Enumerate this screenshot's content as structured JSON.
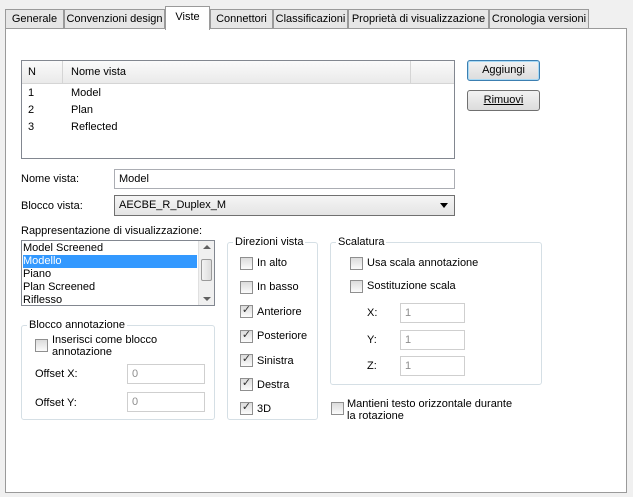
{
  "tabs": [
    {
      "label": "Generale"
    },
    {
      "label": "Convenzioni design"
    },
    {
      "label": "Viste"
    },
    {
      "label": "Connettori"
    },
    {
      "label": "Classificazioni"
    },
    {
      "label": "Proprietà di visualizzazione"
    },
    {
      "label": "Cronologia versioni"
    }
  ],
  "view_list": {
    "columns": [
      "N",
      "Nome vista"
    ],
    "rows": [
      {
        "n": "1",
        "name": "Model"
      },
      {
        "n": "2",
        "name": "Plan"
      },
      {
        "n": "3",
        "name": "Reflected"
      }
    ]
  },
  "buttons": {
    "add": "Aggiungi",
    "remove": "Rimuovi"
  },
  "view_name": {
    "label": "Nome vista:",
    "value": "Model"
  },
  "view_block": {
    "label": "Blocco vista:",
    "value": "AECBE_R_Duplex_M"
  },
  "display_rep": {
    "label": "Rappresentazione di visualizzazione:",
    "items": [
      "Model Screened",
      "Modello",
      "Piano",
      "Plan Screened",
      "Riflesso"
    ],
    "selected": "Modello"
  },
  "annotation_block": {
    "title": "Blocco annotazione",
    "insert_label_1": "Inserisci come blocco",
    "insert_label_2": "annotazione",
    "insert_checked": false,
    "offset_x_label": "Offset X:",
    "offset_x_value": "0",
    "offset_y_label": "Offset Y:",
    "offset_y_value": "0"
  },
  "view_directions": {
    "title": "Direzioni vista",
    "items": [
      {
        "label": "In alto",
        "checked": false
      },
      {
        "label": "In basso",
        "checked": false
      },
      {
        "label": "Anteriore",
        "checked": true
      },
      {
        "label": "Posteriore",
        "checked": true
      },
      {
        "label": "Sinistra",
        "checked": true
      },
      {
        "label": "Destra",
        "checked": true
      },
      {
        "label": "3D",
        "checked": true
      }
    ]
  },
  "scaling": {
    "title": "Scalatura",
    "use_annotation_scale": {
      "label": "Usa scala annotazione",
      "checked": false
    },
    "scale_override": {
      "label": "Sostituzione scala",
      "checked": false
    },
    "x": {
      "label": "X:",
      "value": "1"
    },
    "y": {
      "label": "Y:",
      "value": "1"
    },
    "z": {
      "label": "Z:",
      "value": "1"
    }
  },
  "keep_text": {
    "label_1": "Mantieni testo orizzontale durante",
    "label_2": "la rotazione",
    "checked": false
  },
  "colors": {
    "selection": "#3399ff",
    "accent_border": "#3c7fb1"
  }
}
